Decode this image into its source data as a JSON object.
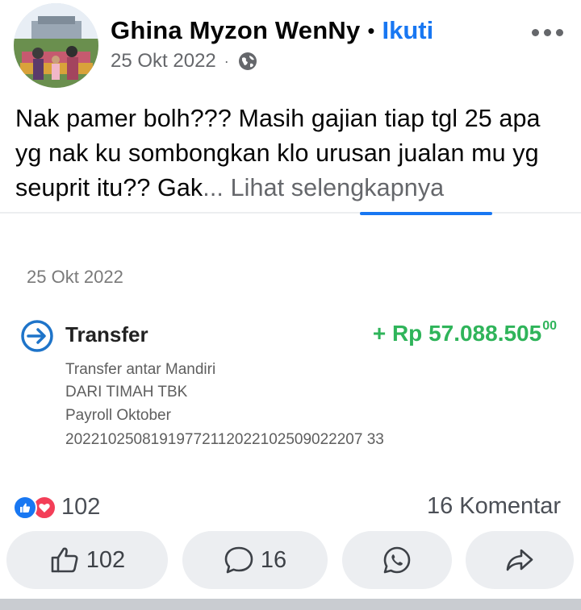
{
  "post": {
    "author": "Ghina Myzon WenNy",
    "separator": "•",
    "follow_label": "Ikuti",
    "date": "25 Okt 2022",
    "meta_dot": "·",
    "audience_icon": "globe-icon",
    "text": "Nak pamer bolh??? Masih gajian tiap tgl 25 apa yg nak ku sombongkan klo urusan jualan mu yg seuprit itu?? Gak",
    "ellipsis": "...",
    "see_more": "Lihat selengkapnya"
  },
  "receipt": {
    "date": "25 Okt 2022",
    "title": "Transfer",
    "amount_main": "+ Rp 57.088.505",
    "amount_cents": "00",
    "line1": "Transfer antar Mandiri",
    "line2": "DARI TIMAH TBK",
    "line3": "Payroll Oktober",
    "line4": "20221025081919772112022102509022207 33"
  },
  "stats": {
    "reaction_count": "102",
    "comments": "16 Komentar"
  },
  "actions": {
    "like_count": "102",
    "comment_count": "16"
  },
  "colors": {
    "accent": "#1877f2",
    "amount_green": "#2fb45a",
    "love_red": "#f33e58",
    "button_bg": "#eceef1"
  }
}
